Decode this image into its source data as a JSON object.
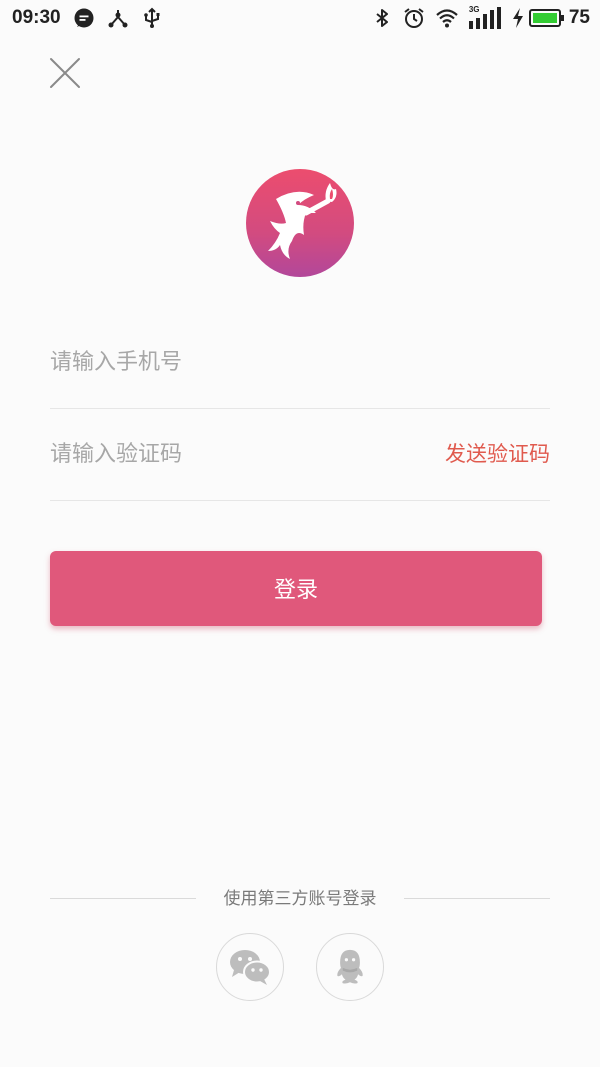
{
  "status_bar": {
    "time": "09:30",
    "battery_level": "75",
    "network_type": "3G",
    "left_icons": [
      "chat-bubble-icon",
      "share-icon",
      "usb-icon"
    ],
    "right_icons": [
      "bluetooth-icon",
      "alarm-icon",
      "wifi-icon",
      "signal-icon",
      "charging-icon",
      "battery-icon"
    ],
    "battery_fill_color": "#33CC33"
  },
  "close": {
    "icon": "close-icon"
  },
  "logo": {
    "icon": "app-logo-icon",
    "gradient": [
      "#EC4D6E",
      "#B2479A"
    ]
  },
  "form": {
    "phone_placeholder": "请输入手机号",
    "code_placeholder": "请输入验证码",
    "send_code_label": "发送验证码",
    "login_label": "登录"
  },
  "third_party": {
    "label": "使用第三方账号登录",
    "providers": [
      {
        "icon": "wechat-icon"
      },
      {
        "icon": "qq-icon"
      }
    ]
  },
  "colors": {
    "accent": "#E0587B",
    "send_code": "#E05A4E",
    "background": "#FBFBFB"
  }
}
